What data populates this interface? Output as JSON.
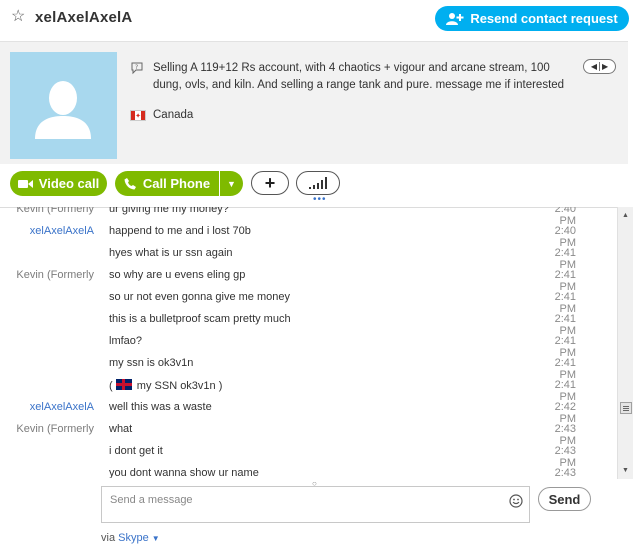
{
  "header": {
    "contact_name": "xelAxelAxelA",
    "resend_label": "Resend contact request"
  },
  "profile": {
    "mood": "Selling A 119+12 Rs account, with 4 chaotics + vigour and arcane stream, 100 dung, ovls, and kiln. And selling a range tank and pure. message me if interested",
    "location": "Canada"
  },
  "actions": {
    "video_label": "Video call",
    "call_label": "Call Phone"
  },
  "messages": [
    {
      "sender": "Kevin (Formerly",
      "text": "ur giving me my money?",
      "time": "2:40 PM"
    },
    {
      "sender": "xelAxelAxelA",
      "text": "happend to me and i lost 70b",
      "time": "2:40 PM"
    },
    {
      "sender": "",
      "text": "hyes what is ur ssn again",
      "time": "2:41 PM"
    },
    {
      "sender": "Kevin (Formerly",
      "text": "so why are u evens eling gp",
      "time": "2:41 PM"
    },
    {
      "sender": "",
      "text": "so ur not even gonna give me money",
      "time": "2:41 PM"
    },
    {
      "sender": "",
      "text": "this is a bulletproof scam pretty much",
      "time": "2:41 PM"
    },
    {
      "sender": "",
      "text": "lmfao?",
      "time": "2:41 PM"
    },
    {
      "sender": "",
      "text": "my ssn is ok3v1n",
      "time": "2:41 PM"
    },
    {
      "sender": "",
      "text": "my SSN ok3v1n )",
      "time": "2:41 PM"
    },
    {
      "sender": "xelAxelAxelA",
      "text": "well this was a waste",
      "time": "2:42 PM"
    },
    {
      "sender": "Kevin (Formerly",
      "text": "what",
      "time": "2:43 PM"
    },
    {
      "sender": "",
      "text": "i dont get it",
      "time": "2:43 PM"
    },
    {
      "sender": "",
      "text": "you dont wanna show ur name",
      "time": "2:43 PM"
    }
  ],
  "flag_message_prefix": "(",
  "composer": {
    "placeholder": "Send a message",
    "send_label": "Send",
    "via_prefix": "via",
    "via_service": "Skype"
  },
  "colors": {
    "skype_blue": "#00aff0",
    "call_green": "#7fba00",
    "link_blue": "#3a73c9",
    "avatar_bg": "#a8d8ee"
  }
}
